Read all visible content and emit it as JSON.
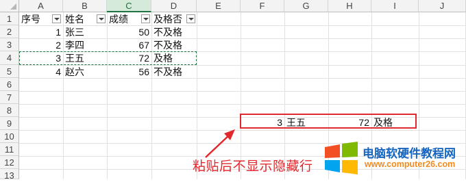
{
  "columns": [
    "A",
    "B",
    "C",
    "D",
    "E",
    "F",
    "G",
    "H",
    "I",
    "J"
  ],
  "rows": [
    "1",
    "2",
    "3",
    "4",
    "5",
    "6",
    "7",
    "8",
    "9",
    "10",
    "11",
    "12",
    "13"
  ],
  "headers": {
    "A1": "序号",
    "B1": "姓名",
    "C1": "成绩",
    "D1": "及格否"
  },
  "table": [
    {
      "id": "1",
      "name": "张三",
      "score": "50",
      "pass": "不及格"
    },
    {
      "id": "2",
      "name": "李四",
      "score": "67",
      "pass": "不及格"
    },
    {
      "id": "3",
      "name": "王五",
      "score": "72",
      "pass": "及格"
    },
    {
      "id": "4",
      "name": "赵六",
      "score": "56",
      "pass": "不及格"
    }
  ],
  "pasted": {
    "id": "3",
    "name": "王五",
    "score": "72",
    "pass": "及格"
  },
  "annotation": "粘贴后不显示隐藏行",
  "watermark": {
    "title": "电脑软硬件教程网",
    "url": "www.computer26.com"
  },
  "colors": {
    "accent_green": "#217346",
    "highlight_red": "#e0282d"
  }
}
